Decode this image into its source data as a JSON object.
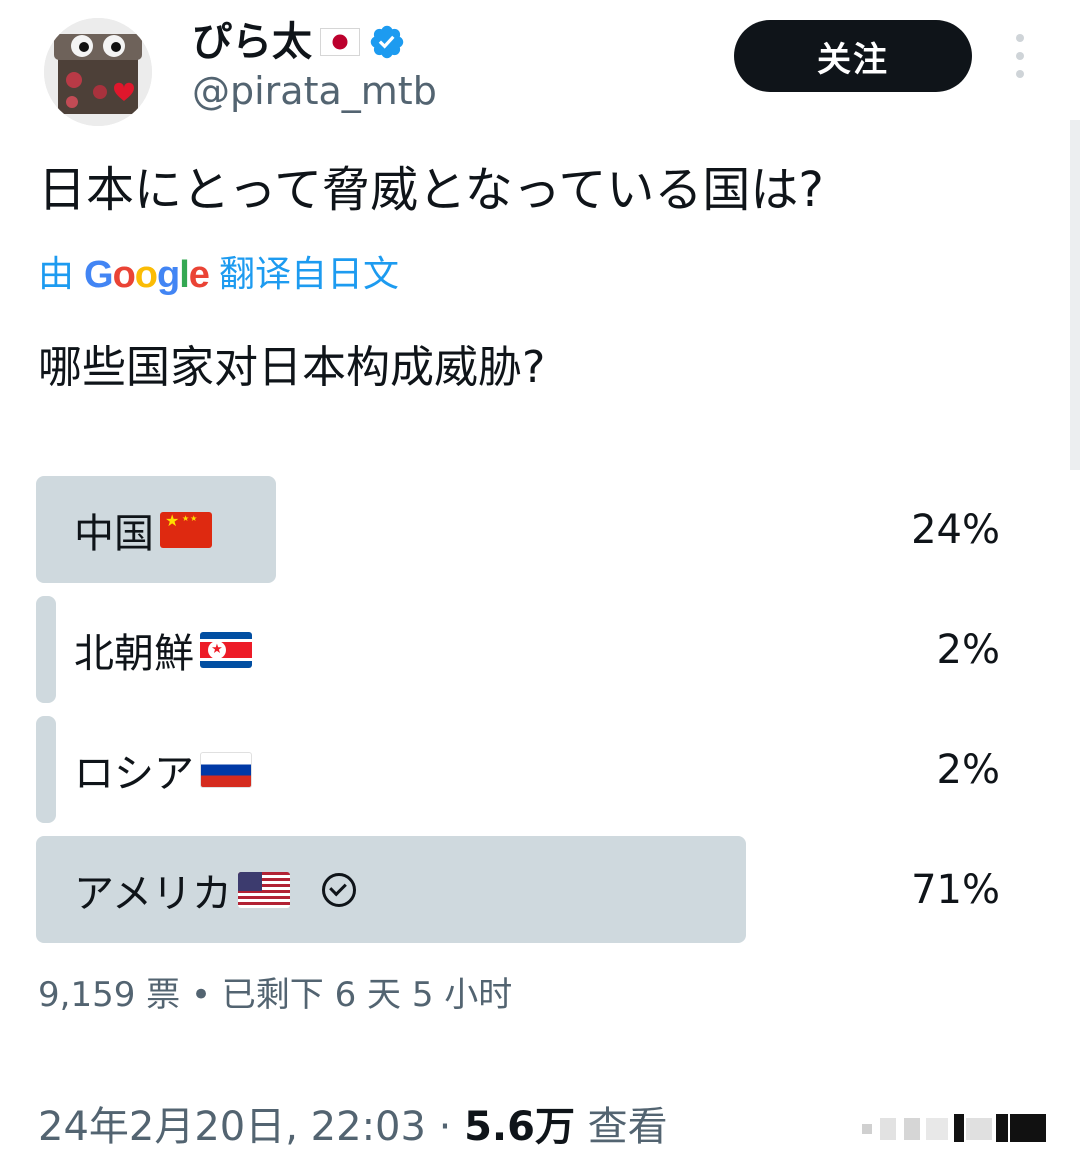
{
  "author": {
    "display_name": "ぴら太",
    "handle": "@pirata_mtb",
    "follow_label": "关注"
  },
  "tweet": {
    "text": "日本にとって脅威となっている国は?",
    "translated_prefix": "由",
    "translated_brand": "Google",
    "translated_suffix": "翻译自日文",
    "translation": "哪些国家对日本构成威胁?"
  },
  "poll": {
    "options": [
      {
        "label": "中国",
        "percent_label": "24%",
        "percent": 24,
        "flag": "china-flag-icon",
        "winner": false
      },
      {
        "label": "北朝鮮",
        "percent_label": "2%",
        "percent": 2,
        "flag": "north-korea-flag-icon",
        "winner": false
      },
      {
        "label": "ロシア",
        "percent_label": "2%",
        "percent": 2,
        "flag": "russia-flag-icon",
        "winner": false
      },
      {
        "label": "アメリカ",
        "percent_label": "71%",
        "percent": 71,
        "flag": "usa-flag-icon",
        "winner": true
      }
    ],
    "meta": "9,159 票 • 已剩下 6 天 5 小时",
    "bar_color": "#cfd9de"
  },
  "footer": {
    "date": "24年2月20日, 22:03 · ",
    "views_count": "5.6万",
    "views_label": " 查看"
  },
  "colors": {
    "text": "#0f1419",
    "secondary": "#536471",
    "link": "#1d9bf0"
  }
}
